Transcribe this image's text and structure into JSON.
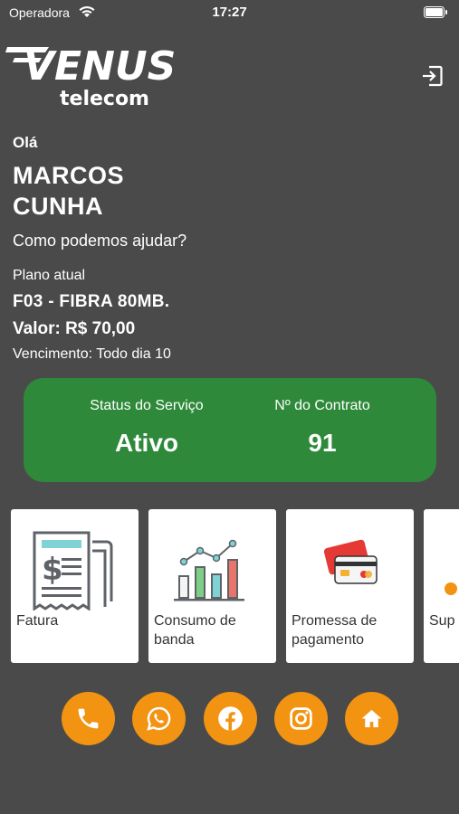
{
  "status_bar": {
    "carrier": "Operadora",
    "time": "17:27"
  },
  "brand": {
    "logo_top": "VENUS",
    "logo_bottom": "telecom"
  },
  "greeting": {
    "hello": "Olá",
    "first_name": "MARCOS",
    "last_name": "CUNHA",
    "help": "Como podemos ajudar?"
  },
  "plan": {
    "label": "Plano atual",
    "name": "F03 - FIBRA 80MB.",
    "price": "Valor: R$ 70,00",
    "due": "Vencimento: Todo dia 10"
  },
  "status_card": {
    "service_label": "Status do Serviço",
    "service_value": "Ativo",
    "contract_label": "Nº do Contrato",
    "contract_value": "91"
  },
  "tiles": [
    {
      "label_1": "Fatura",
      "label_2": "",
      "icon": "invoice-icon"
    },
    {
      "label_1": "Consumo de",
      "label_2": "banda",
      "icon": "bandwidth-chart-icon"
    },
    {
      "label_1": "Promessa de",
      "label_2": "pagamento",
      "icon": "credit-card-icon"
    },
    {
      "label_1": "Sup",
      "label_2": "",
      "icon": "support-icon"
    }
  ],
  "social_buttons": [
    "phone-icon",
    "whatsapp-icon",
    "facebook-icon",
    "instagram-icon",
    "home-icon"
  ],
  "colors": {
    "background": "#4a4a4a",
    "status_card": "#2e8a3a",
    "accent": "#f29312",
    "tile": "#ffffff"
  }
}
